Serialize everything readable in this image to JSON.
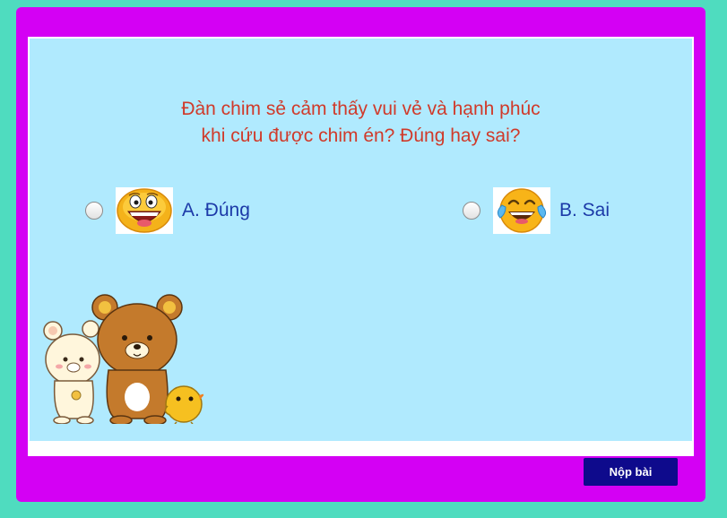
{
  "quiz": {
    "question_line1": "Đàn chim sẻ cảm thấy vui vẻ và hạnh phúc",
    "question_line2": "khi cứu được chim én? Đúng hay sai?",
    "options": [
      {
        "label": "A. Đúng",
        "icon": "laughing-emoji-icon",
        "selected": false
      },
      {
        "label": "B. Sai",
        "icon": "tears-of-joy-emoji-icon",
        "selected": false
      }
    ]
  },
  "footer": {
    "submit_label": "Nộp bài"
  },
  "colors": {
    "page_bg": "#4fdcbf",
    "frame": "#d400f4",
    "quiz_bg": "#b0eafe",
    "question_text": "#d03a2a",
    "option_text": "#1c3aa8",
    "button_bg": "#0e0a8c"
  },
  "illustration": {
    "icon": "bears-and-chick-illustration"
  }
}
